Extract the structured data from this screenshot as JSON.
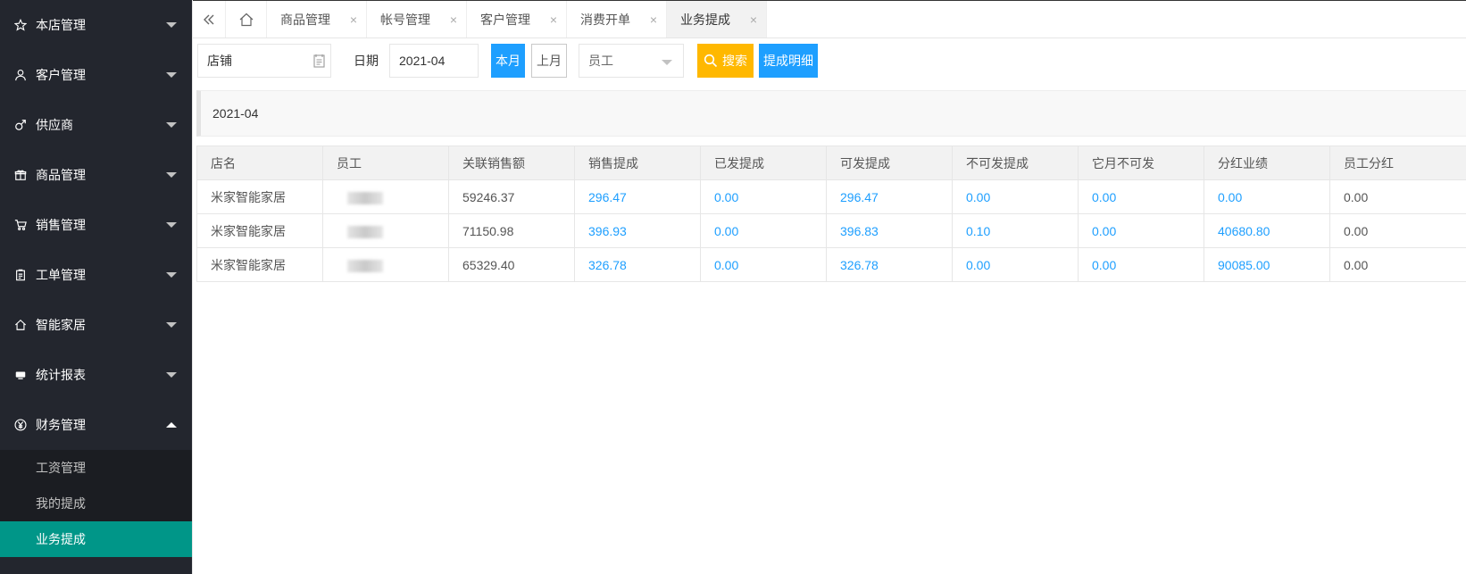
{
  "sidebar": {
    "menus": [
      {
        "label": "本店管理",
        "icon": "star-icon"
      },
      {
        "label": "客户管理",
        "icon": "user-icon"
      },
      {
        "label": "供应商",
        "icon": "male-icon"
      },
      {
        "label": "商品管理",
        "icon": "gift-icon"
      },
      {
        "label": "销售管理",
        "icon": "cart-icon"
      },
      {
        "label": "工单管理",
        "icon": "clipboard-icon"
      },
      {
        "label": "智能家居",
        "icon": "home-icon"
      },
      {
        "label": "统计报表",
        "icon": "monitor-icon"
      },
      {
        "label": "财务管理",
        "icon": "yen-icon"
      }
    ],
    "finance_sub": [
      "工资管理",
      "我的提成",
      "业务提成"
    ]
  },
  "tabs": [
    {
      "label": "商品管理"
    },
    {
      "label": "帐号管理"
    },
    {
      "label": "客户管理"
    },
    {
      "label": "消费开单"
    },
    {
      "label": "业务提成"
    }
  ],
  "tab_close_glyph": "×",
  "filter": {
    "store_value": "店铺",
    "date_label": "日期",
    "date_value": "2021-04",
    "this_month": "本月",
    "last_month": "上月",
    "employee_placeholder": "员工",
    "search": "搜索",
    "detail": "提成明细"
  },
  "period": "2021-04",
  "table": {
    "headers": [
      "店名",
      "员工",
      "关联销售额",
      "销售提成",
      "已发提成",
      "可发提成",
      "不可发提成",
      "它月不可发",
      "分红业绩",
      "员工分红"
    ],
    "rows": [
      [
        "米家智能家居",
        "",
        "59246.37",
        "296.47",
        "0.00",
        "296.47",
        "0.00",
        "0.00",
        "0.00",
        "0.00"
      ],
      [
        "米家智能家居",
        "",
        "71150.98",
        "396.93",
        "0.00",
        "396.83",
        "0.10",
        "0.00",
        "40680.80",
        "0.00"
      ],
      [
        "米家智能家居",
        "",
        "65329.40",
        "326.78",
        "0.00",
        "326.78",
        "0.00",
        "0.00",
        "90085.00",
        "0.00"
      ]
    ]
  },
  "colors": {
    "sidebar_bg": "#23262e",
    "submenu_bg": "#1b1d22",
    "active_teal": "#009688",
    "link_blue": "#1e9fff",
    "search_yellow": "#ffb800"
  }
}
